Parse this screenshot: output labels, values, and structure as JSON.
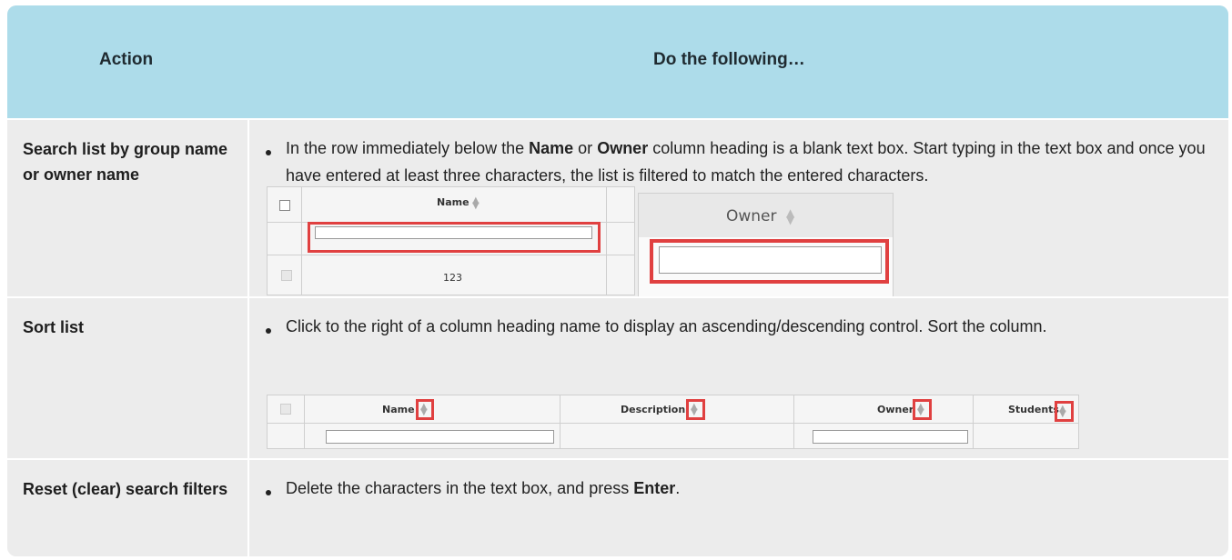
{
  "header": {
    "action": "Action",
    "do": "Do the following…"
  },
  "rows": [
    {
      "action": "Search list by group name or owner name",
      "text_pre1": "In the row immediately below the ",
      "bold1": "Name",
      "text_mid": " or ",
      "bold2": "Owner",
      "text_post": " column heading is a blank text box. Start typing in the text box and once you have entered at least three characters, the list is filtered to match the entered characters."
    },
    {
      "action": "Sort list",
      "text": "Click to the right of a column heading name to display an ascending/descending control. Sort the column."
    },
    {
      "action": "Reset (clear) search filters",
      "text_pre": "Delete the characters in the text box, and press ",
      "bold": "Enter",
      "text_post": "."
    }
  ],
  "shot1": {
    "name_col": "Name",
    "cell_value": "123",
    "owner_col": "Owner"
  },
  "shot2": {
    "cols": [
      "Name",
      "Description",
      "Owner",
      "Students"
    ]
  },
  "icons": {
    "sort": "sort-arrows-icon",
    "checkbox": "checkbox-icon"
  },
  "colors": {
    "header_bg": "#addcea",
    "row_bg": "#ececec",
    "highlight": "#e04040"
  }
}
